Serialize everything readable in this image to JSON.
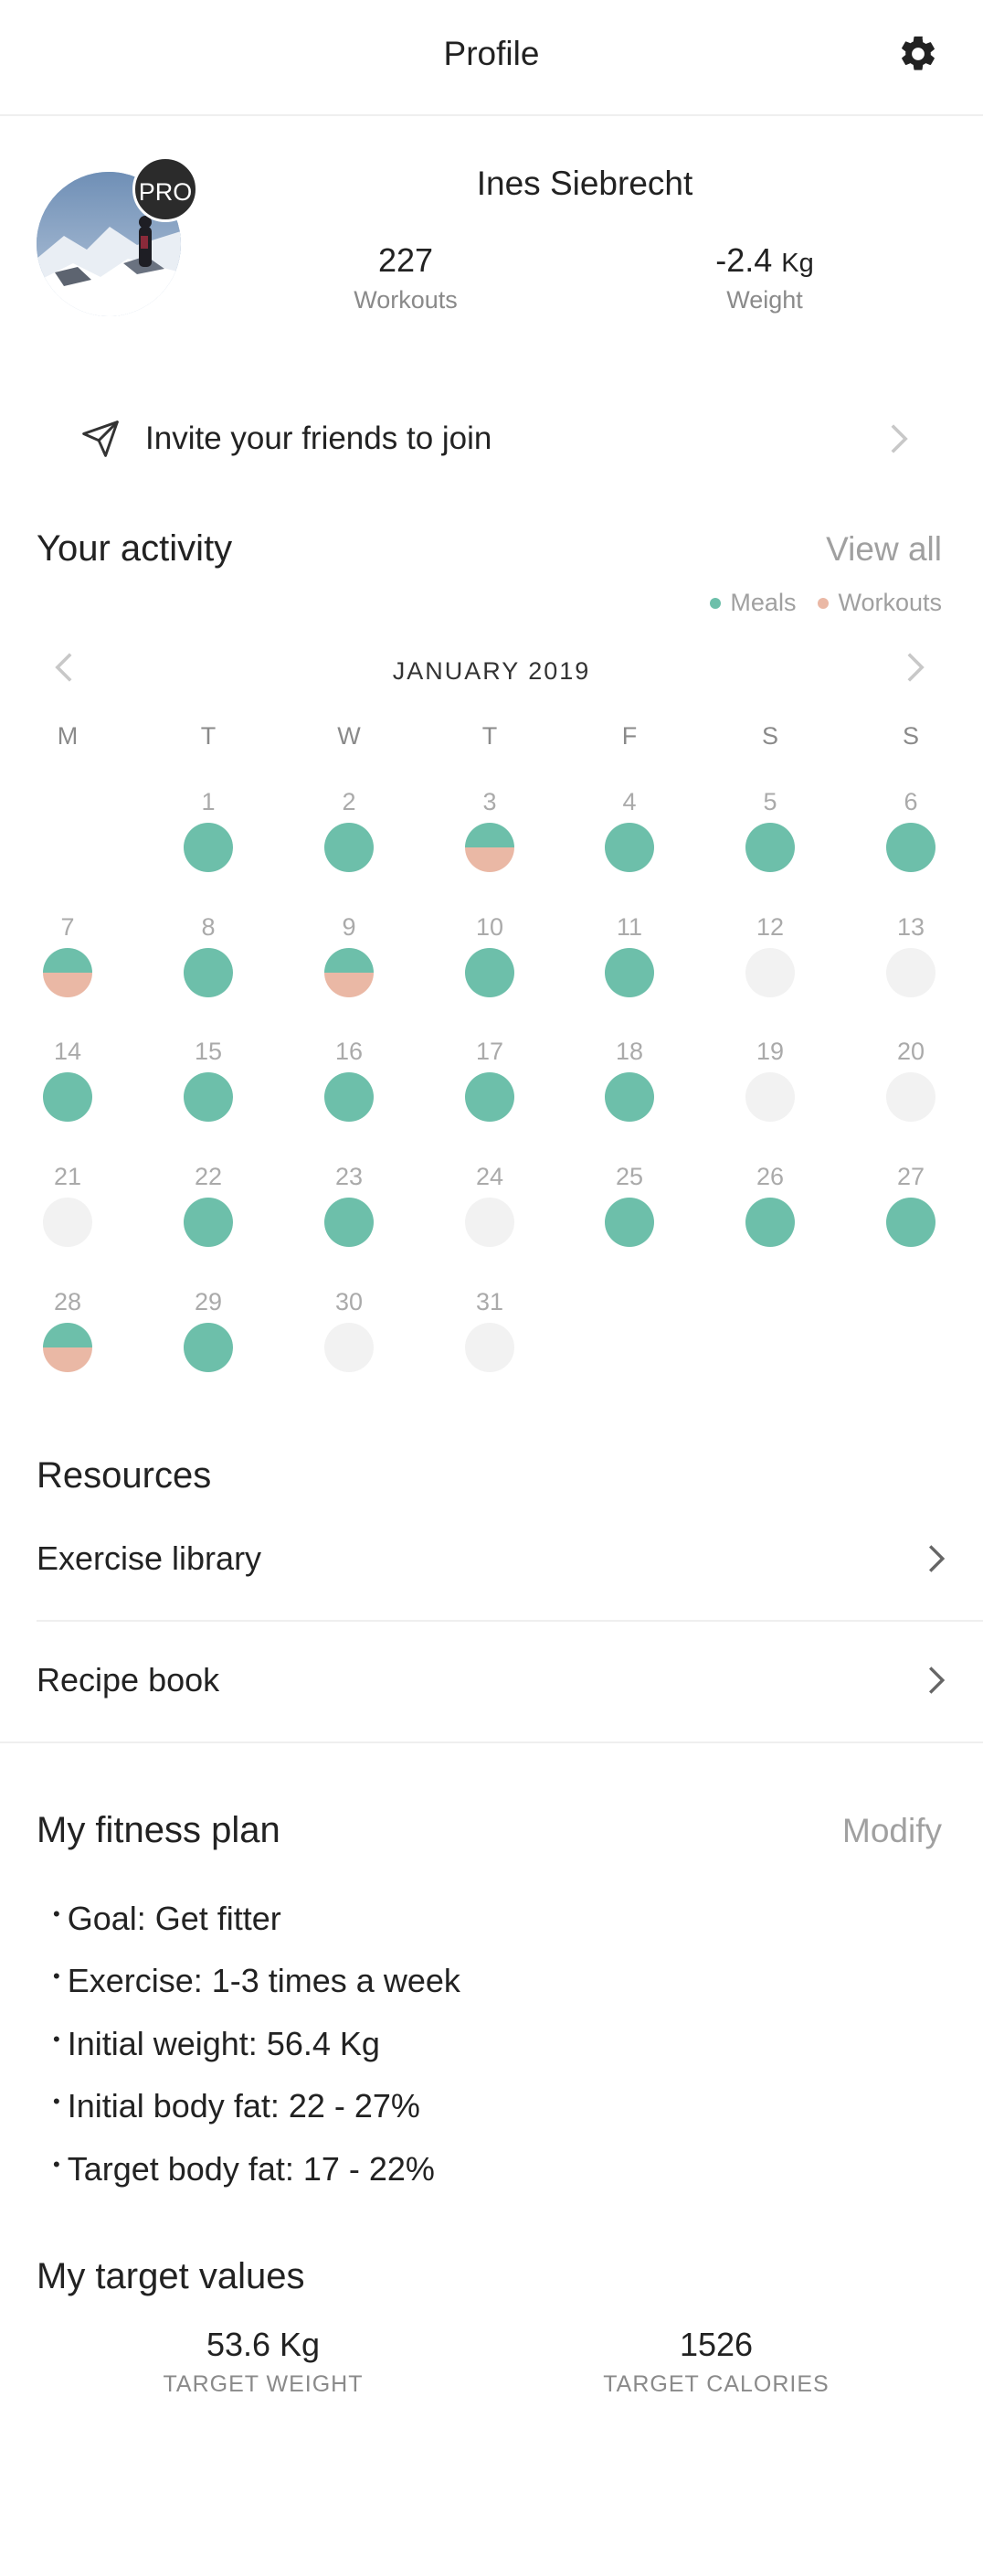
{
  "header": {
    "title": "Profile",
    "settings_icon": "gear-icon"
  },
  "profile": {
    "name": "Ines Siebrecht",
    "badge": "PRO",
    "stats": [
      {
        "value": "227",
        "unit": "",
        "label": "Workouts"
      },
      {
        "value": "-2.4",
        "unit": "Kg",
        "label": "Weight"
      }
    ]
  },
  "invite": {
    "label": "Invite your friends to join",
    "icon": "send-icon"
  },
  "activity": {
    "title": "Your activity",
    "view_all": "View all",
    "legend": [
      {
        "label": "Meals",
        "color": "#6dbfaa"
      },
      {
        "label": "Workouts",
        "color": "#eab8a5"
      }
    ],
    "month": "JANUARY 2019",
    "weekdays": [
      "M",
      "T",
      "W",
      "T",
      "F",
      "S",
      "S"
    ],
    "days": [
      {
        "day": "1",
        "status": "meal"
      },
      {
        "day": "2",
        "status": "meal"
      },
      {
        "day": "3",
        "status": "both"
      },
      {
        "day": "4",
        "status": "meal"
      },
      {
        "day": "5",
        "status": "meal"
      },
      {
        "day": "6",
        "status": "meal"
      },
      {
        "day": "7",
        "status": "both"
      },
      {
        "day": "8",
        "status": "meal"
      },
      {
        "day": "9",
        "status": "both"
      },
      {
        "day": "10",
        "status": "meal"
      },
      {
        "day": "11",
        "status": "meal"
      },
      {
        "day": "12",
        "status": "none"
      },
      {
        "day": "13",
        "status": "none"
      },
      {
        "day": "14",
        "status": "meal"
      },
      {
        "day": "15",
        "status": "meal"
      },
      {
        "day": "16",
        "status": "meal"
      },
      {
        "day": "17",
        "status": "meal"
      },
      {
        "day": "18",
        "status": "meal"
      },
      {
        "day": "19",
        "status": "none"
      },
      {
        "day": "20",
        "status": "none"
      },
      {
        "day": "21",
        "status": "none"
      },
      {
        "day": "22",
        "status": "meal"
      },
      {
        "day": "23",
        "status": "meal"
      },
      {
        "day": "24",
        "status": "none"
      },
      {
        "day": "25",
        "status": "meal"
      },
      {
        "day": "26",
        "status": "meal"
      },
      {
        "day": "27",
        "status": "meal"
      },
      {
        "day": "28",
        "status": "both"
      },
      {
        "day": "29",
        "status": "meal"
      },
      {
        "day": "30",
        "status": "none"
      },
      {
        "day": "31",
        "status": "none"
      }
    ]
  },
  "resources": {
    "title": "Resources",
    "items": [
      {
        "label": "Exercise library"
      },
      {
        "label": "Recipe book"
      }
    ]
  },
  "fitness_plan": {
    "title": "My fitness plan",
    "modify": "Modify",
    "items": [
      "Goal: Get fitter",
      "Exercise: 1-3 times a week",
      "Initial weight: 56.4 Kg",
      "Initial body fat: 22 - 27%",
      "Target body fat: 17 - 22%"
    ]
  },
  "targets": {
    "title": "My target values",
    "items": [
      {
        "value": "53.6 Kg",
        "label": "TARGET WEIGHT"
      },
      {
        "value": "1526",
        "label": "TARGET CALORIES"
      }
    ]
  }
}
